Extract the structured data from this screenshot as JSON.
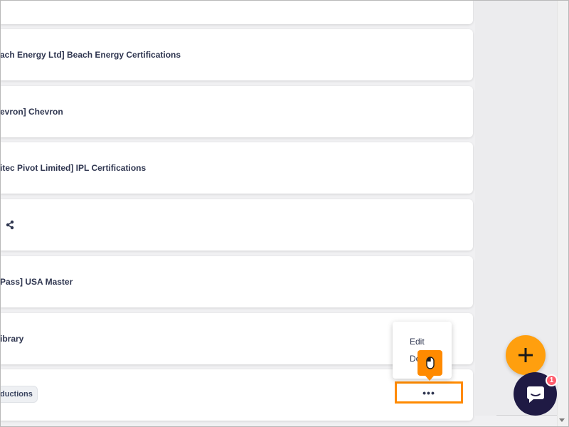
{
  "cards": [
    {
      "title": ""
    },
    {
      "title": "ach Energy Ltd] Beach Energy Certifications"
    },
    {
      "title": "evron] Chevron"
    },
    {
      "title": "itec Pivot Limited] IPL Certifications"
    },
    {
      "title": ""
    },
    {
      "title": "Pass] USA Master"
    },
    {
      "title": "ibrary"
    },
    {
      "chip": "ductions"
    }
  ],
  "context_menu": {
    "items": [
      "Edit",
      "De"
    ]
  },
  "more_button_label": "•••",
  "fab_label": "+",
  "chat": {
    "badge_count": "1"
  },
  "colors": {
    "accent": "#ff8a00",
    "fab": "#ff9f0e",
    "chat": "#1f1a44",
    "text": "#2f3650"
  },
  "icons": [
    "share-icon",
    "mouse-icon",
    "plus-icon",
    "chat-icon",
    "scroll-down-icon"
  ]
}
